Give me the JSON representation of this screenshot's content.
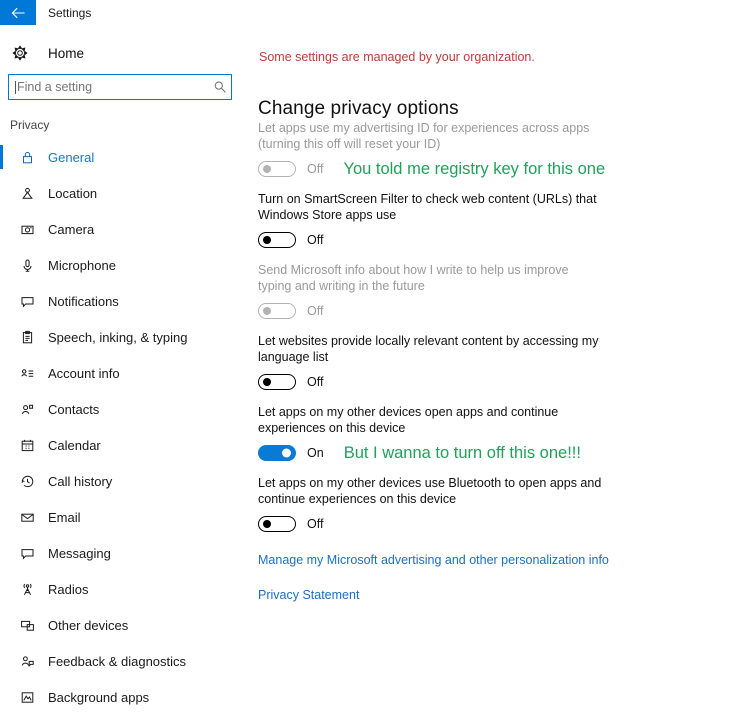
{
  "titlebar": {
    "back_icon": "back-arrow-icon",
    "title": "Settings",
    "accent_color": "#0078d7"
  },
  "sidebar": {
    "home": {
      "icon": "gear-icon",
      "label": "Home"
    },
    "search": {
      "placeholder": "Find a setting",
      "value": "",
      "icon": "search-icon"
    },
    "section_label": "Privacy",
    "items": [
      {
        "label": "General",
        "icon": "lock-icon",
        "selected": true
      },
      {
        "label": "Location",
        "icon": "location-pin-icon",
        "selected": false
      },
      {
        "label": "Camera",
        "icon": "camera-icon",
        "selected": false
      },
      {
        "label": "Microphone",
        "icon": "microphone-icon",
        "selected": false
      },
      {
        "label": "Notifications",
        "icon": "speech-bubble-icon",
        "selected": false
      },
      {
        "label": "Speech, inking, & typing",
        "icon": "clipboard-icon",
        "selected": false
      },
      {
        "label": "Account info",
        "icon": "account-list-icon",
        "selected": false
      },
      {
        "label": "Contacts",
        "icon": "contacts-person-icon",
        "selected": false
      },
      {
        "label": "Calendar",
        "icon": "calendar-icon",
        "selected": false
      },
      {
        "label": "Call history",
        "icon": "clock-history-icon",
        "selected": false
      },
      {
        "label": "Email",
        "icon": "envelope-icon",
        "selected": false
      },
      {
        "label": "Messaging",
        "icon": "message-bubble-icon",
        "selected": false
      },
      {
        "label": "Radios",
        "icon": "broadcast-tower-icon",
        "selected": false
      },
      {
        "label": "Other devices",
        "icon": "devices-icon",
        "selected": false
      },
      {
        "label": "Feedback & diagnostics",
        "icon": "feedback-person-icon",
        "selected": false
      },
      {
        "label": "Background apps",
        "icon": "background-apps-icon",
        "selected": false
      }
    ]
  },
  "main": {
    "managed_note": "Some settings are managed by your organization.",
    "managed_note_color": "#c03a3a",
    "heading": "Change privacy options",
    "annotation_color": "#22a05a",
    "settings": [
      {
        "description": "Let apps use my advertising ID for experiences across apps (turning this off will reset your ID)",
        "state": "Off",
        "on": false,
        "disabled": true,
        "annotation": "You told me registry key for this one"
      },
      {
        "description": "Turn on SmartScreen Filter to check web content (URLs) that Windows Store apps use",
        "state": "Off",
        "on": false,
        "disabled": false,
        "annotation": ""
      },
      {
        "description": "Send Microsoft info about how I write to help us improve typing and writing in the future",
        "state": "Off",
        "on": false,
        "disabled": true,
        "annotation": ""
      },
      {
        "description": "Let websites provide locally relevant content by accessing my language list",
        "state": "Off",
        "on": false,
        "disabled": false,
        "annotation": ""
      },
      {
        "description": "Let apps on my other devices open apps and continue experiences on this device",
        "state": "On",
        "on": true,
        "disabled": false,
        "annotation": "But I wanna to turn off this one!!!"
      },
      {
        "description": "Let apps on my other devices use Bluetooth to open apps and continue experiences on this device",
        "state": "Off",
        "on": false,
        "disabled": false,
        "annotation": ""
      }
    ],
    "links": [
      {
        "label": "Manage my Microsoft advertising and other personalization info"
      },
      {
        "label": "Privacy Statement"
      }
    ]
  }
}
